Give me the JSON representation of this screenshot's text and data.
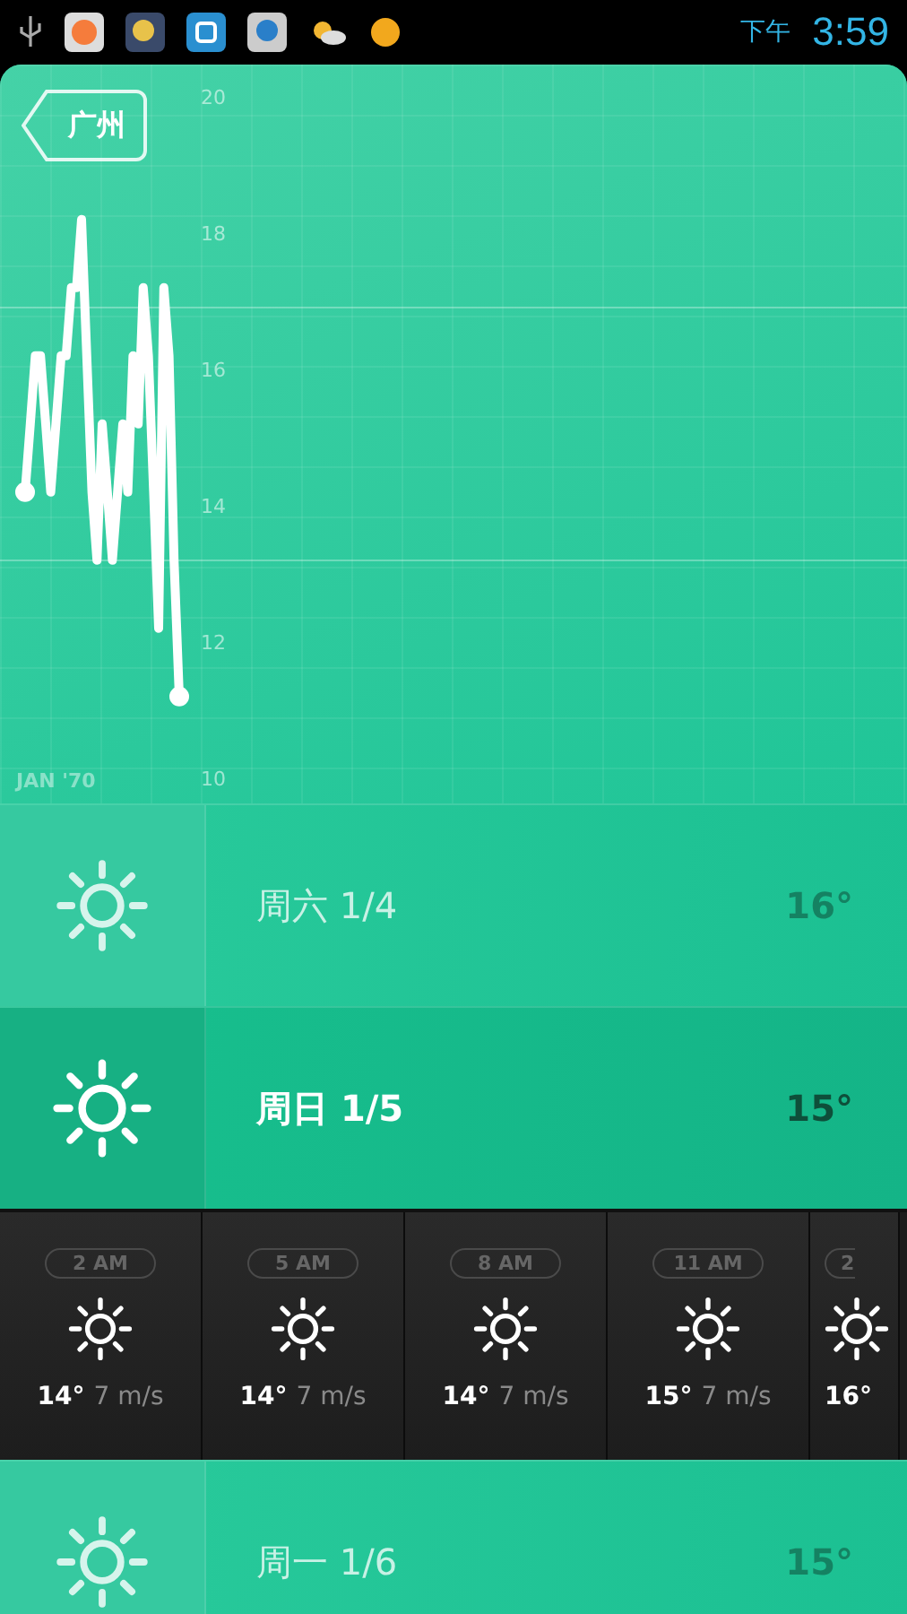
{
  "status_bar": {
    "period": "下午",
    "time": "3:59"
  },
  "city": {
    "label": "广州"
  },
  "chart": {
    "date_label": "JAN '70",
    "chart_data": {
      "type": "line",
      "ylim": [
        10,
        20
      ],
      "yticks": [
        10,
        12,
        14,
        16,
        18,
        20
      ],
      "categories": [
        null,
        null,
        null,
        null,
        null,
        null,
        null,
        null,
        null,
        null,
        null,
        null,
        null,
        null,
        null,
        null,
        null,
        null,
        null,
        null,
        null,
        null,
        null,
        null,
        null,
        null,
        null,
        null,
        null,
        null,
        null
      ],
      "series": [
        {
          "color": "#ffffff",
          "values": [
            14.2,
            15.2,
            16.2,
            16.2,
            15.2,
            14.2,
            15.2,
            16.2,
            16.2,
            17.2,
            17.2,
            18.2,
            16.2,
            14.2,
            13.2,
            15.2,
            14.2,
            13.2,
            14.2,
            15.2,
            14.2,
            16.2,
            15.2,
            17.2,
            16.2,
            14.2,
            12.2,
            17.2,
            16.2,
            13.2,
            11.2
          ]
        }
      ]
    }
  },
  "days_top": [
    {
      "label": "周六 1/4",
      "temp": "16°",
      "selected": false
    },
    {
      "label": "周日 1/5",
      "temp": "15°",
      "selected": true
    }
  ],
  "hourly": [
    {
      "time": "2 AM",
      "temp": "14°",
      "wind": "7 m/s"
    },
    {
      "time": "5 AM",
      "temp": "14°",
      "wind": "7 m/s"
    },
    {
      "time": "8 AM",
      "temp": "14°",
      "wind": "7 m/s"
    },
    {
      "time": "11 AM",
      "temp": "15°",
      "wind": "7 m/s"
    },
    {
      "time": "2",
      "temp": "16°"
    }
  ],
  "days_bottom": [
    {
      "label": "周一 1/6",
      "temp": "15°",
      "selected": false
    }
  ]
}
